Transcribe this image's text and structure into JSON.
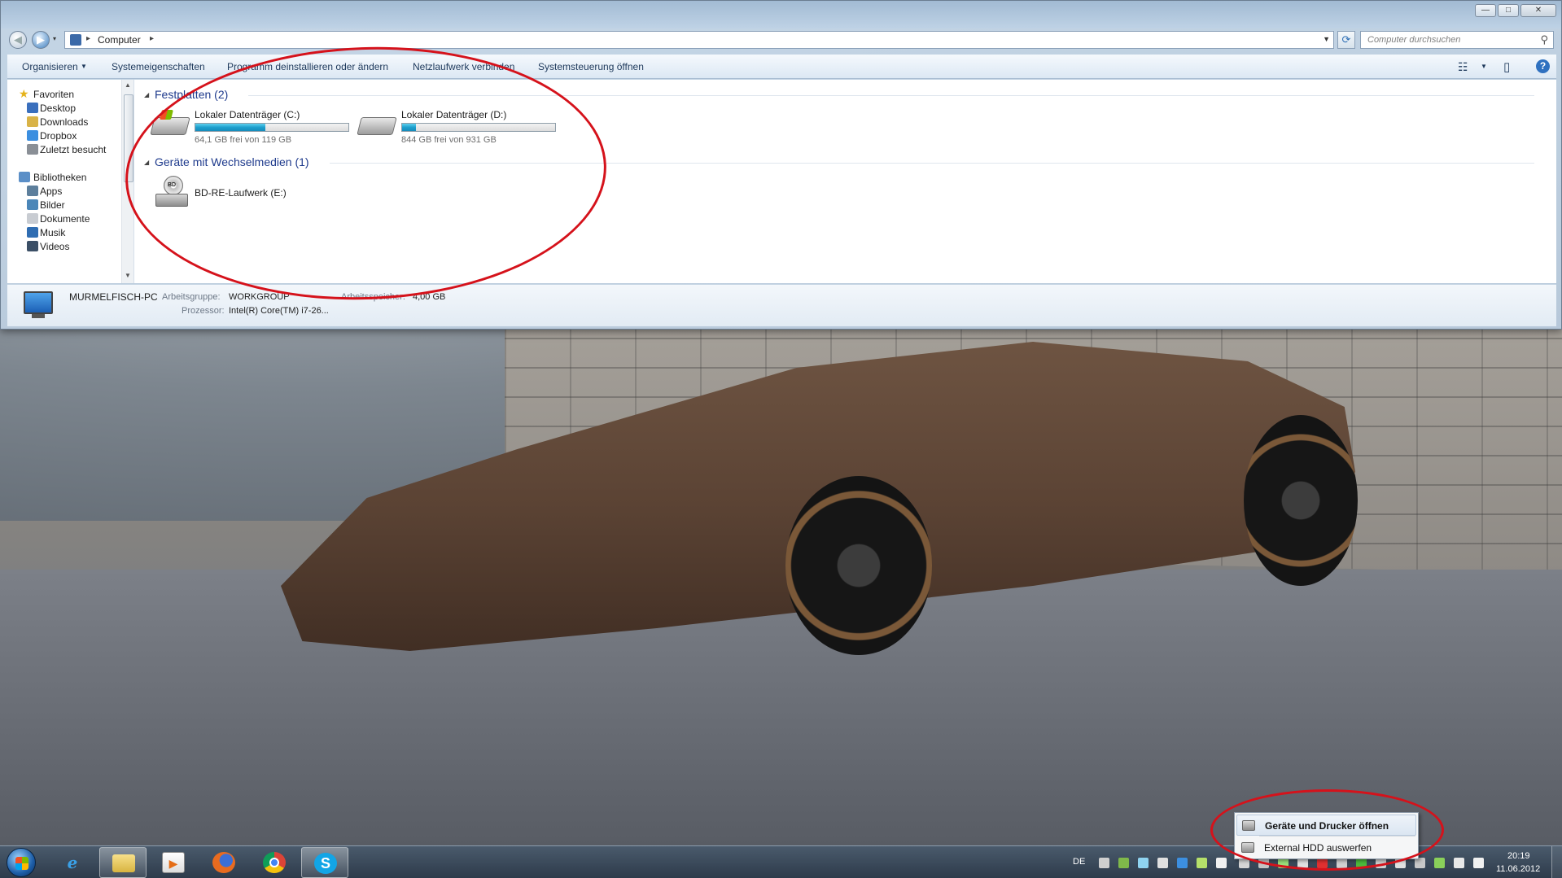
{
  "window": {
    "controls": {
      "minimize": "—",
      "maximize": "□",
      "close": "✕"
    }
  },
  "navbar": {
    "back_glyph": "◀",
    "forward_glyph": "▶",
    "address": {
      "location": "Computer",
      "separator": "▸"
    },
    "search": {
      "placeholder": "Computer durchsuchen"
    }
  },
  "toolbar": {
    "organize": "Organisieren",
    "system_properties": "Systemeigenschaften",
    "uninstall": "Programm deinstallieren oder ändern",
    "map_network_drive": "Netzlaufwerk verbinden",
    "open_control_panel": "Systemsteuerung öffnen",
    "views_glyph": "☷",
    "preview_glyph": "▯",
    "help_glyph": "?"
  },
  "sidebar": {
    "favorites": {
      "label": "Favoriten",
      "items": [
        {
          "label": "Desktop",
          "color": "#3a6fbd"
        },
        {
          "label": "Downloads",
          "color": "#d9b347"
        },
        {
          "label": "Dropbox",
          "color": "#3c8fe0"
        },
        {
          "label": "Zuletzt besucht",
          "color": "#8a8f96"
        }
      ]
    },
    "libraries": {
      "label": "Bibliotheken",
      "items": [
        {
          "label": "Apps",
          "color": "#5d7f9c"
        },
        {
          "label": "Bilder",
          "color": "#4b86b8"
        },
        {
          "label": "Dokumente",
          "color": "#c8ccd2"
        },
        {
          "label": "Musik",
          "color": "#2f6db2"
        },
        {
          "label": "Videos",
          "color": "#3b4f66"
        }
      ]
    }
  },
  "content": {
    "hard_disks": {
      "header": "Festplatten (2)",
      "drives": [
        {
          "name": "Lokaler Datenträger (C:)",
          "free_text": "64,1 GB frei von 119 GB",
          "used_fraction": 0.46
        },
        {
          "name": "Lokaler Datenträger (D:)",
          "free_text": "844 GB frei von 931 GB",
          "used_fraction": 0.09
        }
      ]
    },
    "removable": {
      "header": "Geräte mit Wechselmedien (1)",
      "drives": [
        {
          "name": "BD-RE-Laufwerk (E:)",
          "disc_label": "BD"
        }
      ]
    }
  },
  "details": {
    "computer_name": "MURMELFISCH-PC",
    "workgroup_label": "Arbeitsgruppe:",
    "workgroup_value": "WORKGROUP",
    "memory_label": "Arbeitsspeicher:",
    "memory_value": "4,00 GB",
    "processor_label": "Prozessor:",
    "processor_value": "Intel(R) Core(TM) i7-26..."
  },
  "taskbar": {
    "apps": [
      {
        "name": "Internet Explorer",
        "glyph": "e"
      },
      {
        "name": "Windows Explorer",
        "glyph": ""
      },
      {
        "name": "Media Player",
        "glyph": "▶"
      },
      {
        "name": "Firefox",
        "glyph": ""
      },
      {
        "name": "Chrome",
        "glyph": ""
      },
      {
        "name": "Skype",
        "glyph": "S"
      }
    ],
    "language": "DE",
    "clock_time": "20:19",
    "clock_date": "11.06.2012"
  },
  "tray_menu": {
    "items": [
      {
        "label": "Geräte und Drucker öffnen"
      },
      {
        "label": "External HDD auswerfen"
      }
    ]
  },
  "colors": {
    "annotation_red": "#d5121b",
    "drive_bar_fill": "#1d9fcd",
    "group_header": "#1e3a8c"
  }
}
